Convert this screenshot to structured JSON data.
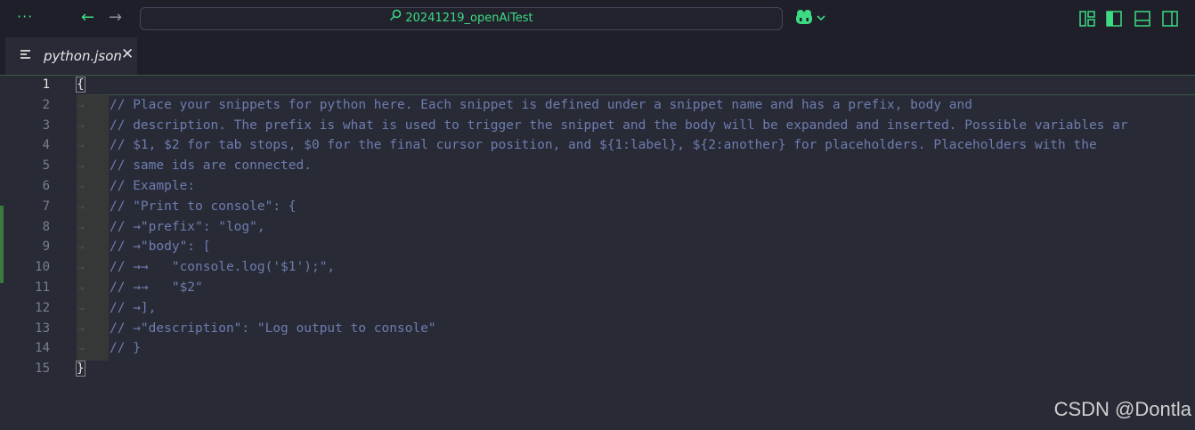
{
  "titlebar": {
    "more_icon": "ellipsis-icon",
    "back_icon": "arrow-left-icon",
    "forward_icon": "arrow-right-icon",
    "search_text": "20241219_openAiTest",
    "copilot_icon": "copilot-icon",
    "layout_icons": [
      "customize-layout-icon",
      "toggle-primary-sidebar-icon",
      "toggle-panel-icon",
      "toggle-secondary-sidebar-icon"
    ],
    "accent_color": "#3ddc84"
  },
  "tab": {
    "label": "python.json",
    "close_label": "✕"
  },
  "editor": {
    "line_numbers": [
      "1",
      "2",
      "3",
      "4",
      "5",
      "6",
      "7",
      "8",
      "9",
      "10",
      "11",
      "12",
      "13",
      "14",
      "15"
    ],
    "lines": [
      "{",
      "// Place your snippets for python here. Each snippet is defined under a snippet name and has a prefix, body and",
      "// description. The prefix is what is used to trigger the snippet and the body will be expanded and inserted. Possible variables ar",
      "// $1, $2 for tab stops, $0 for the final cursor position, and ${1:label}, ${2:another} for placeholders. Placeholders with the",
      "// same ids are connected.",
      "// Example:",
      "// \"Print to console\": {",
      "// →\"prefix\": \"log\",",
      "// →\"body\": [",
      "// →→   \"console.log('$1');\",",
      "// →→   \"$2\"",
      "// →],",
      "// →\"description\": \"Log output to console\"",
      "// }",
      "}"
    ]
  },
  "watermark": "CSDN @Dontla"
}
